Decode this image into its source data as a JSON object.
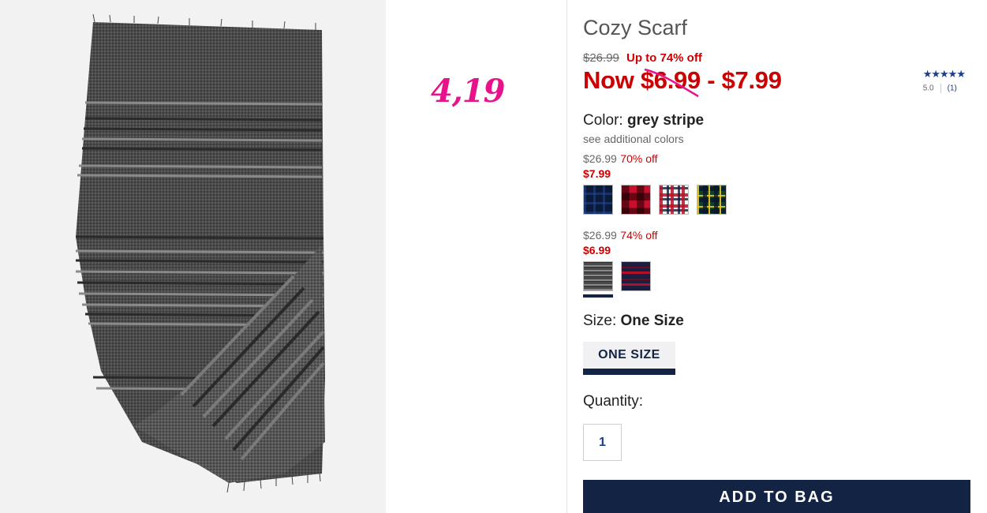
{
  "annotation": {
    "text": "4,19",
    "color": "#e8138b"
  },
  "product": {
    "title": "Cozy Scarf",
    "original_price": "$26.99",
    "discount_text": "Up to 74% off",
    "now_price": "Now $6.99 - $7.99",
    "rating": {
      "stars": "★★★★★",
      "score": "5.0",
      "count": "(1)"
    }
  },
  "color": {
    "label": "Color:",
    "selected": "grey stripe",
    "see_more": "see additional colors",
    "groups": [
      {
        "original": "$26.99",
        "off": "70% off",
        "sale": "$7.99",
        "swatches": [
          "navy-plaid-swatch",
          "red-buffalo-check-swatch",
          "white-red-plaid-swatch",
          "green-tartan-swatch"
        ]
      },
      {
        "original": "$26.99",
        "off": "74% off",
        "sale": "$6.99",
        "swatches": [
          "grey-stripe-swatch",
          "navy-red-stripe-swatch"
        ]
      }
    ]
  },
  "size": {
    "label": "Size:",
    "selected": "One Size",
    "button": "ONE SIZE"
  },
  "quantity": {
    "label": "Quantity:",
    "value": "1"
  },
  "cta": {
    "label": "ADD TO BAG"
  },
  "colors": {
    "sale_red": "#cc0000",
    "navy": "#122344",
    "link_blue": "#1a3f8f"
  }
}
